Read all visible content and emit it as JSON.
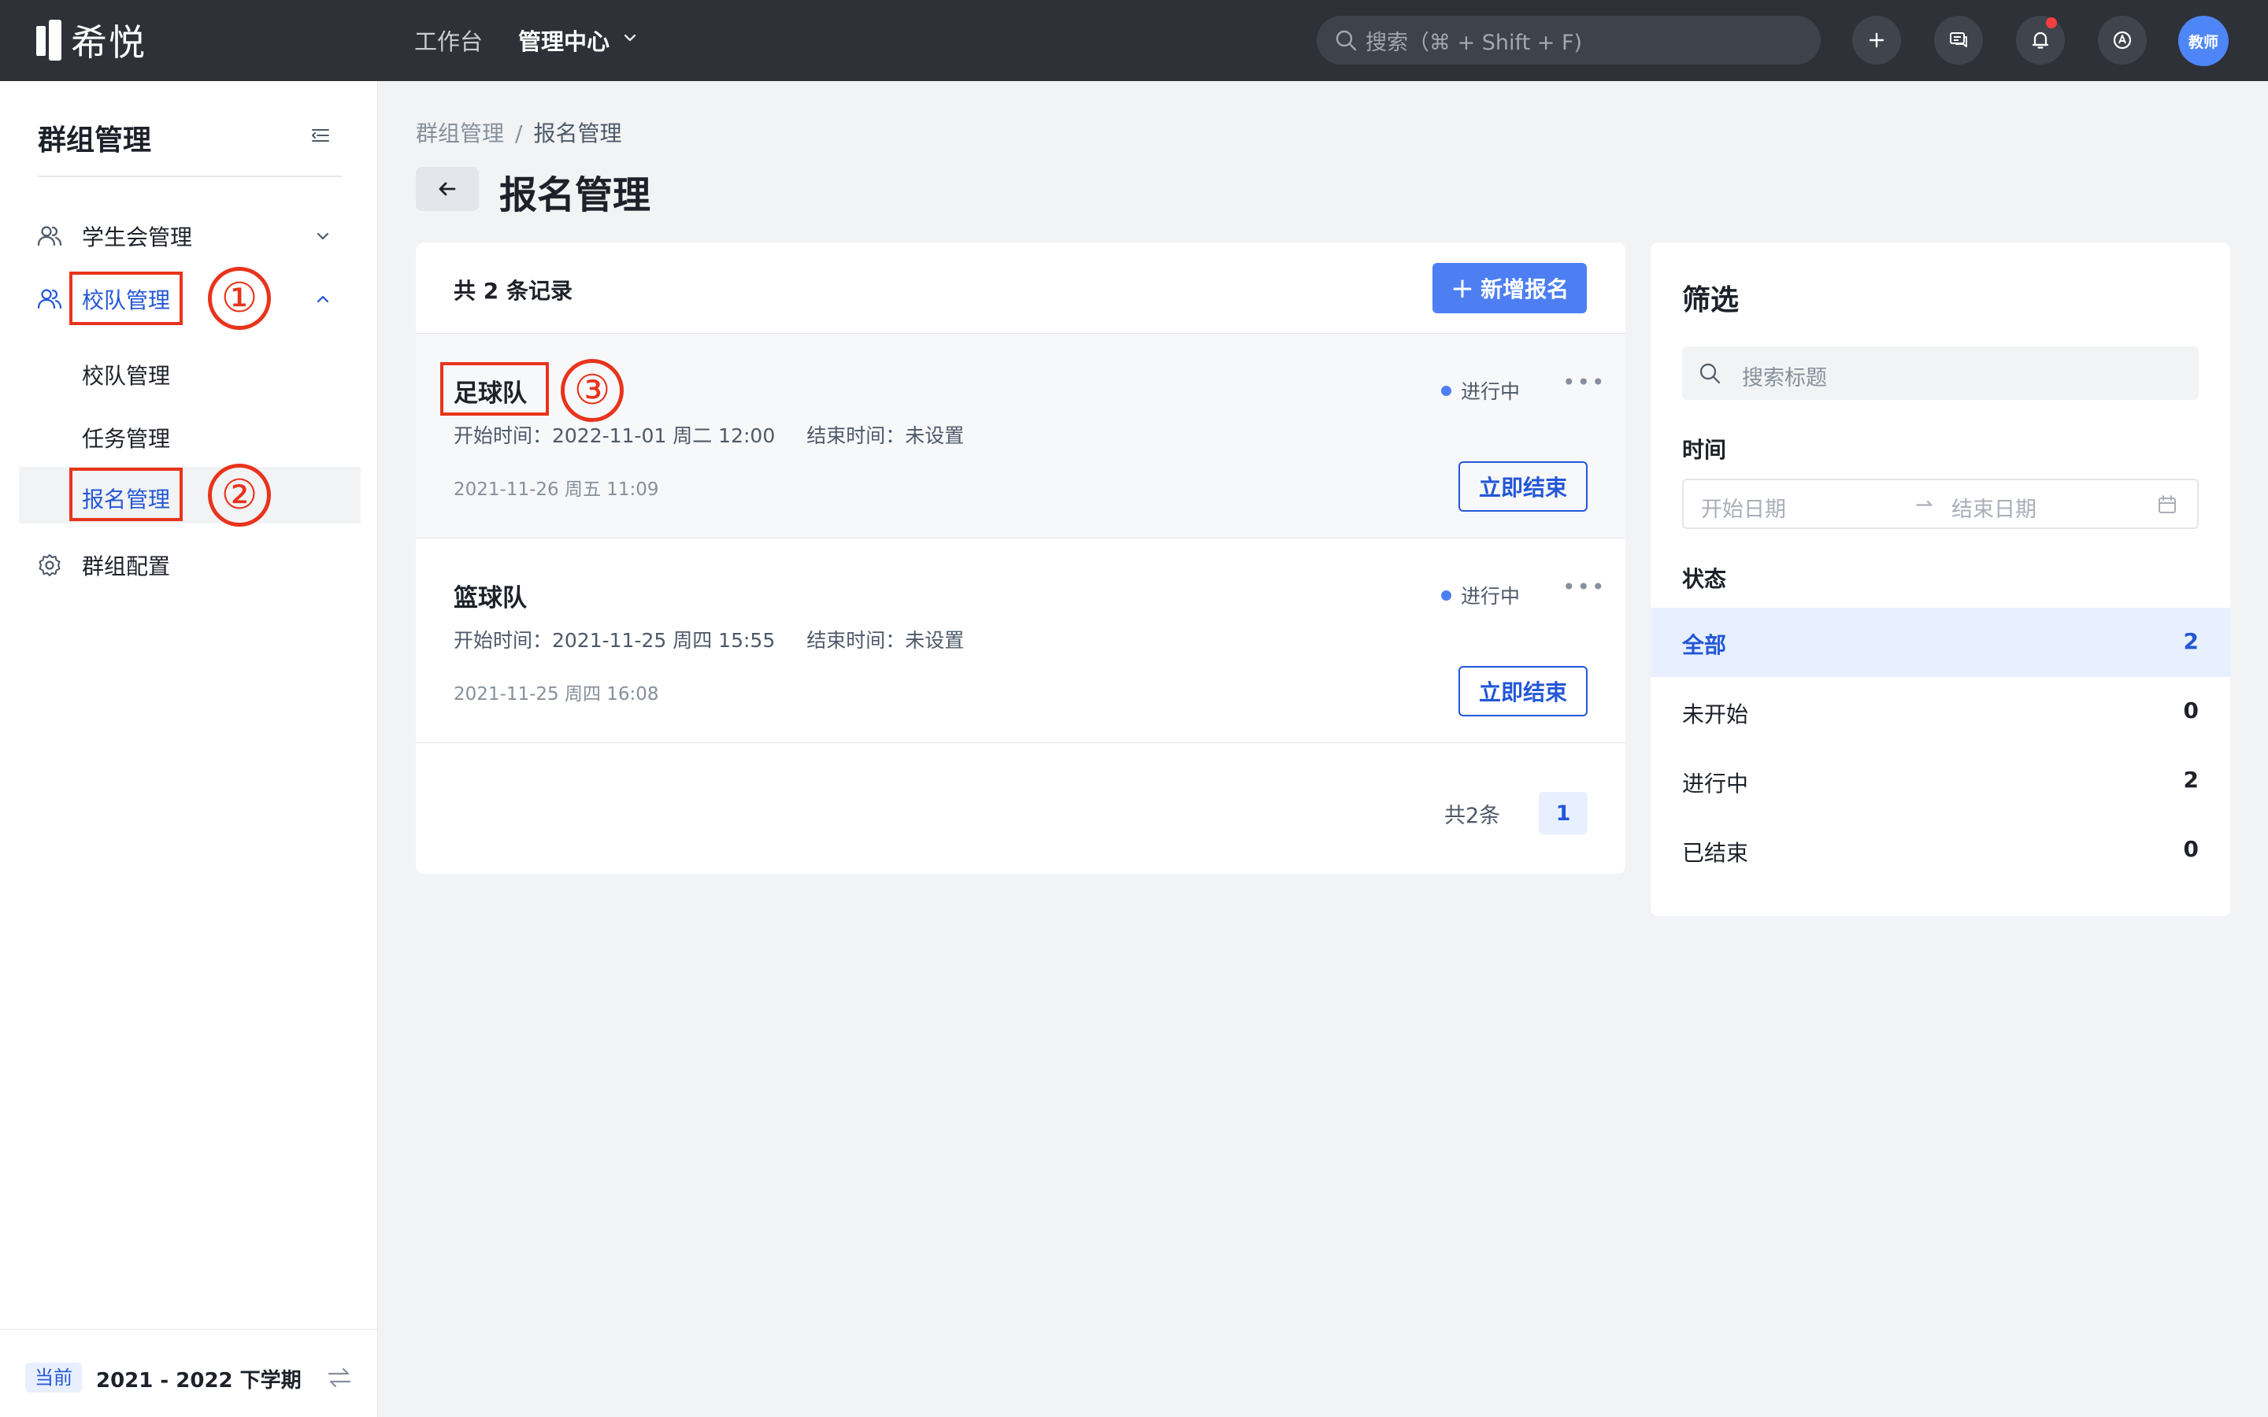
{
  "topbar": {
    "brand": "希悦",
    "nav": [
      {
        "label": "工作台"
      },
      {
        "label": "管理中心"
      }
    ],
    "search_placeholder": "搜索（⌘ + Shift + F)",
    "avatar_text": "教师"
  },
  "sidebar": {
    "title": "群组管理",
    "items": [
      {
        "label": "学生会管理"
      },
      {
        "label": "校队管理"
      },
      {
        "label": "群组配置"
      }
    ],
    "subitems": [
      {
        "label": "校队管理"
      },
      {
        "label": "任务管理"
      },
      {
        "label": "报名管理"
      }
    ],
    "footer": {
      "tag": "当前",
      "term": "2021 - 2022 下学期"
    }
  },
  "annotations": [
    "①",
    "②",
    "③"
  ],
  "breadcrumb": {
    "parent": "群组管理",
    "separator": "/",
    "current": "报名管理"
  },
  "page_title": "报名管理",
  "list": {
    "count_text": "共 2 条记录",
    "add_button": "新增报名",
    "rows": [
      {
        "name": "足球队",
        "status": "进行中",
        "start": "开始时间：2022-11-01 周二 12:00",
        "end": "结束时间：未设置",
        "created": "2021-11-26 周五 11:09",
        "action": "立即结束"
      },
      {
        "name": "篮球队",
        "status": "进行中",
        "start": "开始时间：2021-11-25 周四 15:55",
        "end": "结束时间：未设置",
        "created": "2021-11-25 周四 16:08",
        "action": "立即结束"
      }
    ],
    "pager_total": "共2条",
    "pager_page": "1"
  },
  "filter": {
    "title": "筛选",
    "search_placeholder": "搜索标题",
    "time_label": "时间",
    "start_date_placeholder": "开始日期",
    "end_date_placeholder": "结束日期",
    "status_label": "状态",
    "options": [
      {
        "label": "全部",
        "count": "2"
      },
      {
        "label": "未开始",
        "count": "0"
      },
      {
        "label": "进行中",
        "count": "2"
      },
      {
        "label": "已结束",
        "count": "0"
      }
    ]
  },
  "colors": {
    "topbar_bg": "#2e3138",
    "accent": "#2457d6",
    "primary_button": "#4e7ff2",
    "annotation_red": "#e8341c"
  }
}
